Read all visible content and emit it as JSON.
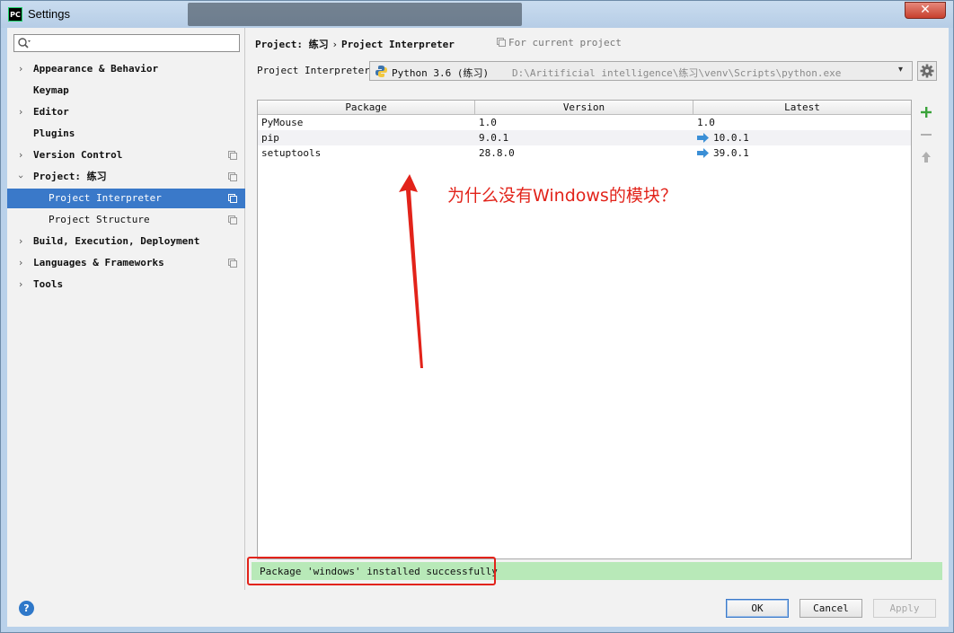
{
  "window": {
    "title": "Settings",
    "app_badge": "PC"
  },
  "sidebar": {
    "search_placeholder": "",
    "items": [
      {
        "label": "Appearance & Behavior"
      },
      {
        "label": "Keymap"
      },
      {
        "label": "Editor"
      },
      {
        "label": "Plugins"
      },
      {
        "label": "Version Control"
      },
      {
        "label": "Project: 练习"
      },
      {
        "label": "Project Interpreter"
      },
      {
        "label": "Project Structure"
      },
      {
        "label": "Build, Execution, Deployment"
      },
      {
        "label": "Languages & Frameworks"
      },
      {
        "label": "Tools"
      }
    ]
  },
  "header": {
    "crumb_project": "Project: 练习",
    "crumb_page": "Project Interpreter",
    "for_current": "For current project"
  },
  "interpreter": {
    "label": "Project Interpreter:",
    "name": "Python 3.6 (练习)",
    "path": "D:\\Aritificial intelligence\\练习\\venv\\Scripts\\python.exe"
  },
  "table": {
    "columns": [
      "Package",
      "Version",
      "Latest"
    ],
    "rows": [
      {
        "package": "PyMouse",
        "version": "1.0",
        "latest": "1.0"
      },
      {
        "package": "pip",
        "version": "9.0.1",
        "latest": "10.0.1"
      },
      {
        "package": "setuptools",
        "version": "28.8.0",
        "latest": "39.0.1"
      }
    ]
  },
  "status": {
    "message": "Package 'windows' installed successfully"
  },
  "buttons": {
    "ok": "OK",
    "cancel": "Cancel",
    "apply": "Apply",
    "help": "?"
  },
  "annotation": {
    "text": "为什么没有Windows的模块？"
  },
  "colors": {
    "selection": "#3a79c9",
    "status_success": "#b8e9b8",
    "annotation_red": "#e2231a",
    "add_green": "#3aa33a",
    "upgrade_blue": "#3b8fd6"
  }
}
